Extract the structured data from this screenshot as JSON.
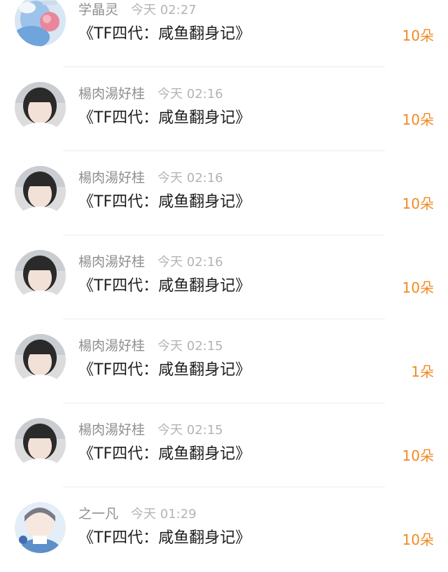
{
  "gifts": [
    {
      "user": "学晶灵",
      "time": "今天 02:27",
      "title": "《TF四代：咸鱼翻身记》",
      "amount": "10朵",
      "avatar": "avatar-anime-pink-hair"
    },
    {
      "user": "楊肉湯好桂",
      "time": "今天 02:16",
      "title": "《TF四代：咸鱼翻身记》",
      "amount": "10朵",
      "avatar": "avatar-short-hair-girl"
    },
    {
      "user": "楊肉湯好桂",
      "time": "今天 02:16",
      "title": "《TF四代：咸鱼翻身记》",
      "amount": "10朵",
      "avatar": "avatar-short-hair-girl"
    },
    {
      "user": "楊肉湯好桂",
      "time": "今天 02:16",
      "title": "《TF四代：咸鱼翻身记》",
      "amount": "10朵",
      "avatar": "avatar-short-hair-girl"
    },
    {
      "user": "楊肉湯好桂",
      "time": "今天 02:15",
      "title": "《TF四代：咸鱼翻身记》",
      "amount": "1朵",
      "avatar": "avatar-short-hair-girl"
    },
    {
      "user": "楊肉湯好桂",
      "time": "今天 02:15",
      "title": "《TF四代：咸鱼翻身记》",
      "amount": "10朵",
      "avatar": "avatar-short-hair-girl"
    },
    {
      "user": "之一凡",
      "time": "今天 01:29",
      "title": "《TF四代：咸鱼翻身记》",
      "amount": "10朵",
      "avatar": "avatar-anime-blue-boy"
    }
  ],
  "colors": {
    "amount": "#f08a24",
    "username": "#8e8e8e",
    "time": "#b4b4b4",
    "title": "#1e1e1e",
    "divider": "#ececec"
  }
}
